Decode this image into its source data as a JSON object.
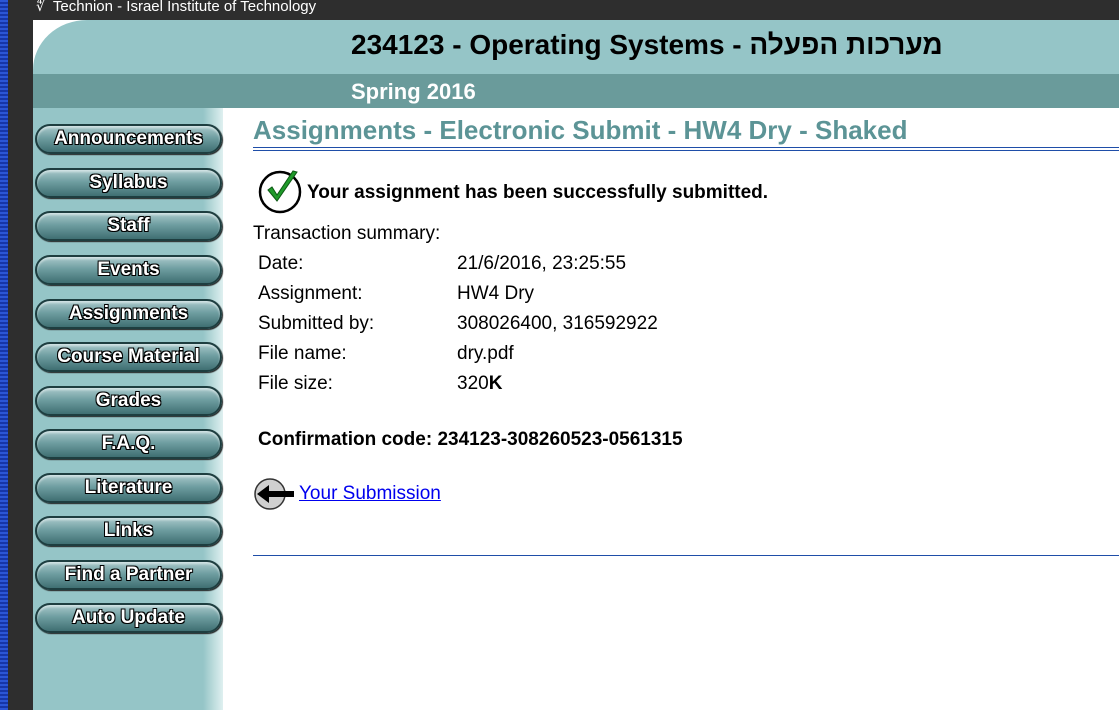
{
  "institution": "Technion - Israel Institute of Technology",
  "course": {
    "title": "234123 - Operating Systems - מערכות הפעלה",
    "semester": "Spring 2016"
  },
  "sidebar": {
    "items": [
      {
        "label": "Announcements"
      },
      {
        "label": "Syllabus"
      },
      {
        "label": "Staff"
      },
      {
        "label": "Events"
      },
      {
        "label": "Assignments"
      },
      {
        "label": "Course Material"
      },
      {
        "label": "Grades"
      },
      {
        "label": "F.A.Q."
      },
      {
        "label": "Literature"
      },
      {
        "label": "Links"
      },
      {
        "label": "Find a Partner"
      },
      {
        "label": "Auto Update"
      }
    ]
  },
  "main": {
    "page_title": "Assignments - Electronic Submit - HW4 Dry - Shaked",
    "success_message": "Your assignment has been successfully submitted.",
    "summary_label": "Transaction summary:",
    "summary": [
      {
        "key": "Date:",
        "value": "21/6/2016, 23:25:55"
      },
      {
        "key": "Assignment:",
        "value": "HW4 Dry"
      },
      {
        "key": "Submitted by:",
        "value": "308026400, 316592922"
      },
      {
        "key": "File name:",
        "value": "dry.pdf"
      }
    ],
    "file_size": {
      "key": "File size:",
      "number": "320",
      "unit": "K"
    },
    "confirmation": "Confirmation code: 234123-308260523-0561315",
    "back_link": "Your Submission"
  },
  "icons": {
    "logo": "technion-logo-icon",
    "success": "checkmark-circle-icon",
    "back": "back-arrow-icon"
  },
  "colors": {
    "header_light": "#95c5c7",
    "header_dark": "#6a9b9b",
    "title_teal": "#5c9496",
    "link_blue": "#0000ee",
    "check_green": "#1f9a2a"
  }
}
